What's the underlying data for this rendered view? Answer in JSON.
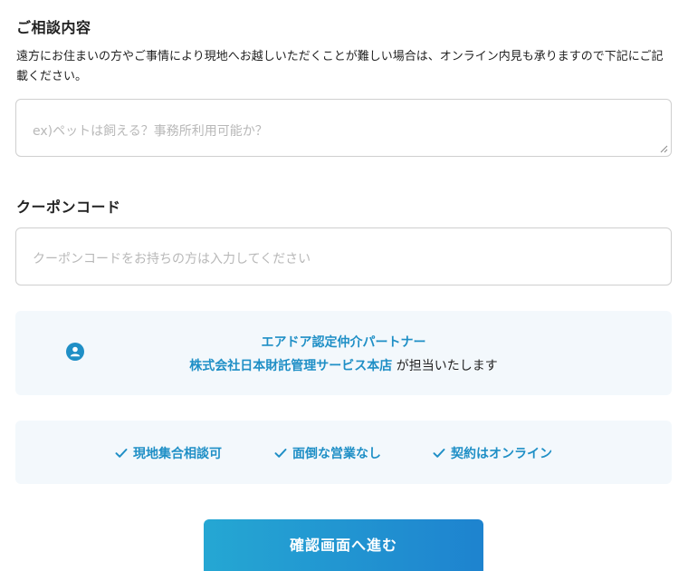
{
  "consultation": {
    "heading": "ご相談内容",
    "description": "遠方にお住まいの方やご事情により現地へお越しいただくことが難しい場合は、オンライン内見も承りますので下記にご記載ください。",
    "placeholder": "ex)ペットは飼える？事務所利用可能か？"
  },
  "coupon": {
    "heading": "クーポンコード",
    "placeholder": "クーポンコードをお持ちの方は入力してください"
  },
  "partner": {
    "title": "エアドア認定仲介パートナー",
    "company": "株式会社日本財託管理サービス本店",
    "suffix": " が担当いたします",
    "icon": "person-circle-icon"
  },
  "features": [
    {
      "label": "現地集合相談可",
      "icon": "check-icon"
    },
    {
      "label": "面倒な営業なし",
      "icon": "check-icon"
    },
    {
      "label": "契約はオンライン",
      "icon": "check-icon"
    }
  ],
  "submit": {
    "label": "確認画面へ進む"
  },
  "colors": {
    "accent": "#1f8fc6",
    "panel_bg": "#f3f8fc",
    "button_gradient_start": "#25a7d3",
    "button_gradient_end": "#1e83cf"
  }
}
